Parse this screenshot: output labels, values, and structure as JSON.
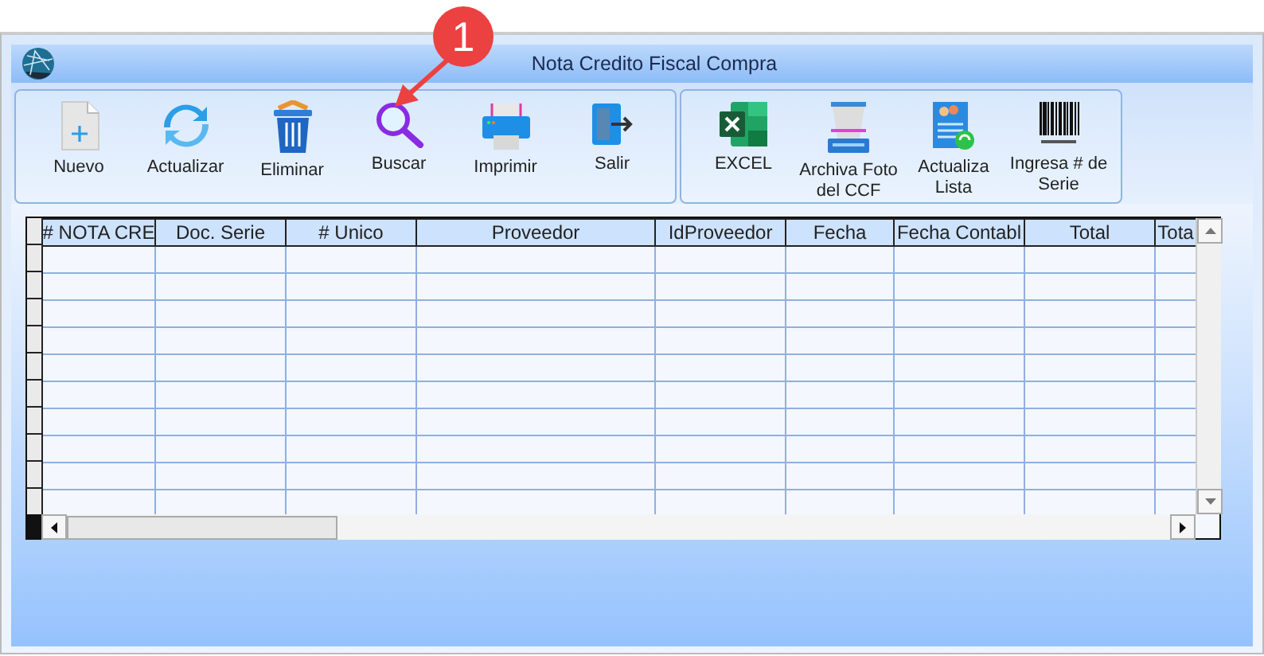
{
  "window": {
    "title": "Nota Credito Fiscal Compra"
  },
  "toolbar_groups": [
    {
      "buttons": [
        {
          "label": "Nuevo",
          "kind": "new"
        },
        {
          "label": "Actualizar",
          "kind": "refresh"
        },
        {
          "label": "Eliminar",
          "kind": "delete"
        },
        {
          "label": "Buscar",
          "kind": "search"
        },
        {
          "label": "Imprimir",
          "kind": "print"
        },
        {
          "label": "Salir",
          "kind": "exit"
        }
      ]
    },
    {
      "buttons": [
        {
          "label": "EXCEL",
          "kind": "excel"
        },
        {
          "label": "Archiva Foto del CCF",
          "kind": "scanner"
        },
        {
          "label": "Actualiza Lista",
          "kind": "list"
        },
        {
          "label": "Ingresa # de Serie",
          "kind": "barcode"
        }
      ]
    }
  ],
  "table": {
    "columns": [
      "# NOTA CRE",
      "Doc. Serie",
      "# Unico",
      "Proveedor",
      "IdProveedor",
      "Fecha",
      "Fecha Contabl",
      "Total",
      "Tota"
    ]
  },
  "annotation": {
    "label": "1"
  }
}
